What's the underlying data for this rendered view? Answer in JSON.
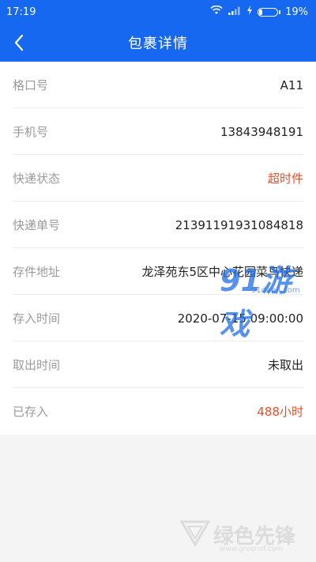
{
  "status_bar": {
    "time": "17:19",
    "battery_percent": "19%",
    "battery_level": 0.19,
    "icons": [
      "wifi-icon",
      "signal-icon",
      "charging-icon",
      "battery-icon"
    ]
  },
  "header": {
    "title": "包裹详情",
    "back_icon": "chevron-left-icon"
  },
  "details": [
    {
      "label": "格口号",
      "value": "A11",
      "highlight": false
    },
    {
      "label": "手机号",
      "value": "13843948191",
      "highlight": false
    },
    {
      "label": "快递状态",
      "value": "超时件",
      "highlight": true
    },
    {
      "label": "快递单号",
      "value": "21391191931084818",
      "highlight": false
    },
    {
      "label": "存件地址",
      "value": "龙泽苑东5区中心花园菜鸟快递",
      "highlight": false
    },
    {
      "label": "存入时间",
      "value": "2020-07-15 09:00:00",
      "highlight": false
    },
    {
      "label": "取出时间",
      "value": "未取出",
      "highlight": false
    },
    {
      "label": "已存入",
      "value": "488小时",
      "highlight": true
    }
  ],
  "colors": {
    "primary": "#1668f0",
    "alert": "#e0502c",
    "label": "#9a9a9a",
    "value": "#222222"
  },
  "watermarks": {
    "site_logo": "91游戏",
    "site_url": "91danji.com",
    "bottom_logo": "绿色先锋",
    "bottom_url": "www.greenxf.com"
  }
}
